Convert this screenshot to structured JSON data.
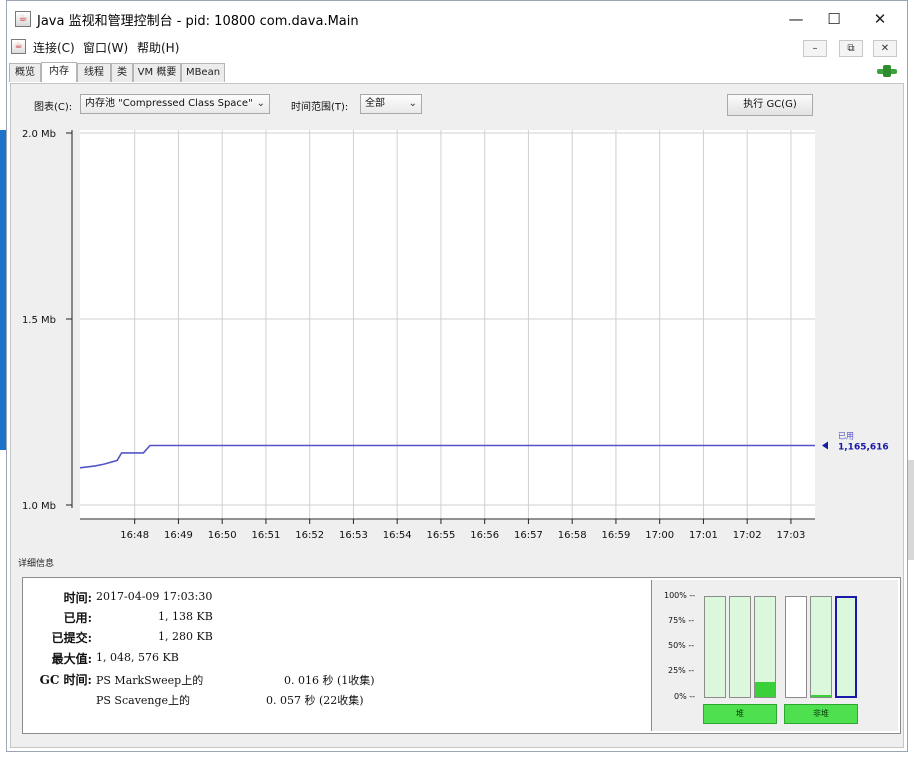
{
  "window": {
    "title": "Java 监视和管理控制台 - pid: 10800 com.dava.Main",
    "minimize": "—",
    "maximize": "☐",
    "close": "✕"
  },
  "menubar": {
    "items": [
      "连接(C)",
      "窗口(W)",
      "帮助(H)"
    ],
    "mdi_min": "–",
    "mdi_restore": "⧉",
    "mdi_close": "✕"
  },
  "tabs": [
    "概览",
    "内存",
    "线程",
    "类",
    "VM 概要",
    "MBean"
  ],
  "active_tab": "内存",
  "controls": {
    "chart_label": "图表(C):",
    "chart_value": "内存池 \"Compressed Class Space\"",
    "time_label": "时间范围(T):",
    "time_value": "全部",
    "gc_button": "执行 GC(G)"
  },
  "chart_data": {
    "type": "line",
    "title": "",
    "xlabel": "",
    "ylabel": "",
    "ylim": [
      1.0,
      2.0
    ],
    "y_unit": "Mb",
    "y_ticks": [
      {
        "value": 2.0,
        "label": "2.0 Mb"
      },
      {
        "value": 1.5,
        "label": "1.5 Mb"
      },
      {
        "value": 1.0,
        "label": "1.0 Mb"
      }
    ],
    "x_ticks": [
      "16:48",
      "16:49",
      "16:50",
      "16:51",
      "16:52",
      "16:53",
      "16:54",
      "16:55",
      "16:56",
      "16:57",
      "16:58",
      "16:59",
      "17:00",
      "17:01",
      "17:02",
      "17:03"
    ],
    "xlim_minutes": [
      16.75,
      33.55
    ],
    "grid": true,
    "series": [
      {
        "name": "已用",
        "color": "#5454c8",
        "points": [
          [
            16.75,
            1.1
          ],
          [
            17.1,
            1.105
          ],
          [
            17.3,
            1.11
          ],
          [
            17.6,
            1.12
          ],
          [
            17.7,
            1.14
          ],
          [
            18.2,
            1.14
          ],
          [
            18.35,
            1.16
          ],
          [
            33.55,
            1.16
          ]
        ]
      }
    ],
    "legend": {
      "label": "已用",
      "value": "1,165,616",
      "placement": "right"
    }
  },
  "details": {
    "section_label": "详细信息",
    "time_label": "时间:",
    "time_value": "2017-04-09 17:03:30",
    "used_label": "已用:",
    "used_value": "1, 138 KB",
    "committed_label": "已提交:",
    "committed_value": "1, 280 KB",
    "max_label": "最大值:",
    "max_value": "1, 048, 576 KB",
    "gc_label": "GC 时间:",
    "gc_rows": [
      {
        "name": "PS MarkSweep上的",
        "value": "0. 016 秒 (1收集)"
      },
      {
        "name": "PS Scavenge上的",
        "value": "0. 057 秒 (22收集)"
      }
    ]
  },
  "pool_chart": {
    "pct_labels": [
      "100% --",
      "75% --",
      "50% --",
      "25% --",
      "0% --"
    ],
    "heap_button": "堆",
    "nonheap_button": "非堆",
    "bars": [
      {
        "group": "heap",
        "committed": 1.0,
        "used": 0.0
      },
      {
        "group": "heap",
        "committed": 1.0,
        "used": 0.0
      },
      {
        "group": "heap",
        "committed": 1.0,
        "used": 0.15
      },
      {
        "group": "nonheap",
        "committed": 0.0,
        "used": 0.0
      },
      {
        "group": "nonheap",
        "committed": 1.0,
        "used": 0.02
      },
      {
        "group": "nonheap",
        "committed": 1.0,
        "used": 0.0,
        "selected": true
      }
    ],
    "fill_color": "#3ad03a",
    "committed_color": "#dcf8dc",
    "selected_color": "#1a1aa8"
  }
}
